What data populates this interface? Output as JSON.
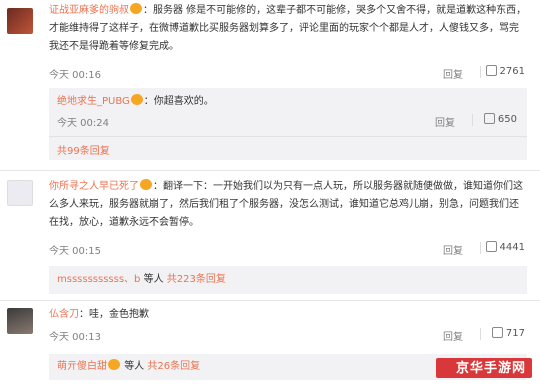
{
  "comments": [
    {
      "user": "证战亚麻爹的驹叔",
      "text": "：服务器 修是不可能修的，这辈子都不可能修，哭多个又舍不得，就是道歉这种东西，才能维持得了这样子，在微博道歉比买服务器划算多了，评论里面的玩家个个都是人才，人傻钱又多，骂完我还不是得跪着等修复完成。",
      "time": "今天 00:16",
      "reply_label": "回复",
      "likes": "2761",
      "sub": {
        "user": "绝地求生_PUBG",
        "text": "：你超喜欢的。",
        "time": "今天 00:24",
        "reply_label": "回复",
        "likes": "650",
        "more": "共99条回复"
      }
    },
    {
      "user": "你所寻之人早已死了",
      "text": "：翻译一下：一开始我们以为只有一点人玩，所以服务器就随便做做，谁知道你们这么多人来玩，服务器就崩了，然后我们租了个服务器，没怎么测试，谁知道它总鸡儿崩，别急，问题我们还在找，放心，道歉永远不会暂停。",
      "time": "今天 00:15",
      "reply_label": "回复",
      "likes": "4441",
      "sub": {
        "user": "msssssssssss、b",
        "text": "等人",
        "more": "共223条回复"
      }
    },
    {
      "user": "仏含刀",
      "text": "：哇，金色抱歉",
      "time": "今天 00:13",
      "reply_label": "回复",
      "likes": "717",
      "sub": {
        "user": "萌亓傻白甜",
        "text": "等人",
        "more": "共26条回复"
      }
    }
  ],
  "watermark": "京华手游网",
  "colors": {
    "link": "#eb7350",
    "meta": "#808080",
    "sub_bg": "#f2f2f5"
  }
}
